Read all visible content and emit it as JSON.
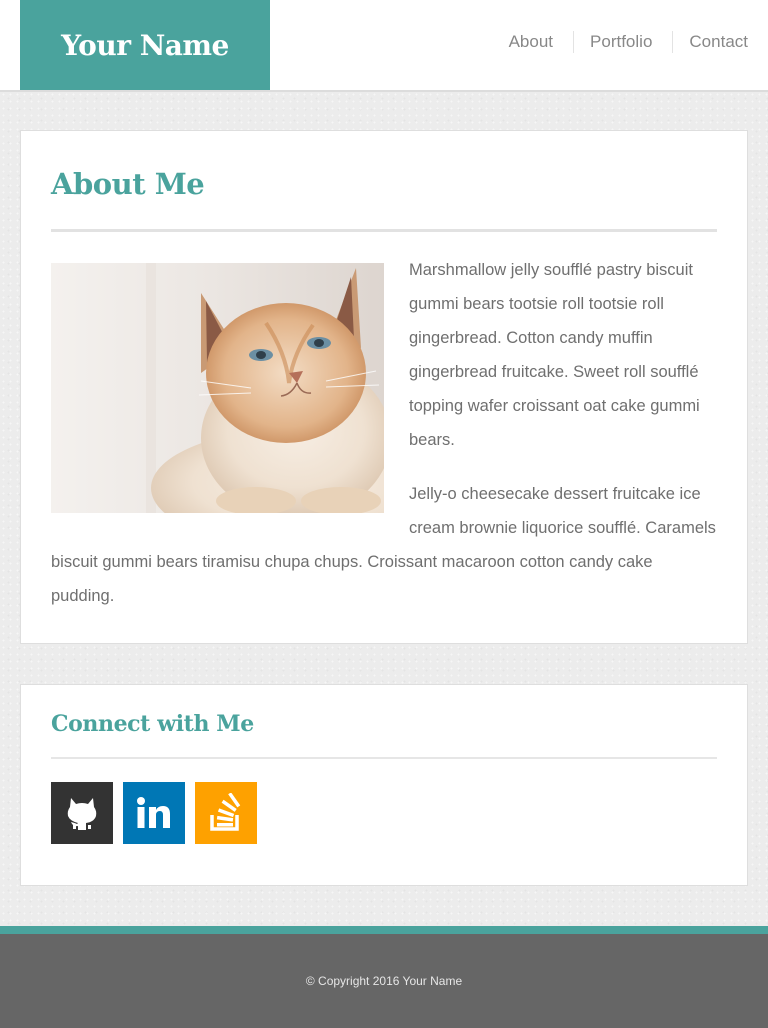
{
  "header": {
    "logo_text": "Your Name",
    "nav": [
      {
        "label": "About"
      },
      {
        "label": "Portfolio"
      },
      {
        "label": "Contact"
      }
    ]
  },
  "about": {
    "title": "About Me",
    "paragraph_1": "Marshmallow jelly soufflé pastry biscuit gummi bears tootsie roll tootsie roll gingerbread. Cotton candy muffin gingerbread fruitcake. Sweet roll soufflé topping wafer croissant oat cake gummi bears.",
    "paragraph_2": "Jelly-o cheesecake dessert fruitcake ice cream brownie liquorice soufflé. Caramels biscuit gummi bears tiramisu chupa chups. Croissant macaroon cotton candy cake pudding."
  },
  "connect": {
    "title": "Connect with Me",
    "links": [
      {
        "icon": "github-icon",
        "color": "#333333"
      },
      {
        "icon": "linkedin-icon",
        "color": "#0077b5"
      },
      {
        "icon": "stackoverflow-icon",
        "color": "#fea100"
      }
    ]
  },
  "footer": {
    "copyright": "© Copyright 2016 Your Name"
  },
  "colors": {
    "accent": "#4aa39d",
    "footer_bg": "#666666"
  }
}
